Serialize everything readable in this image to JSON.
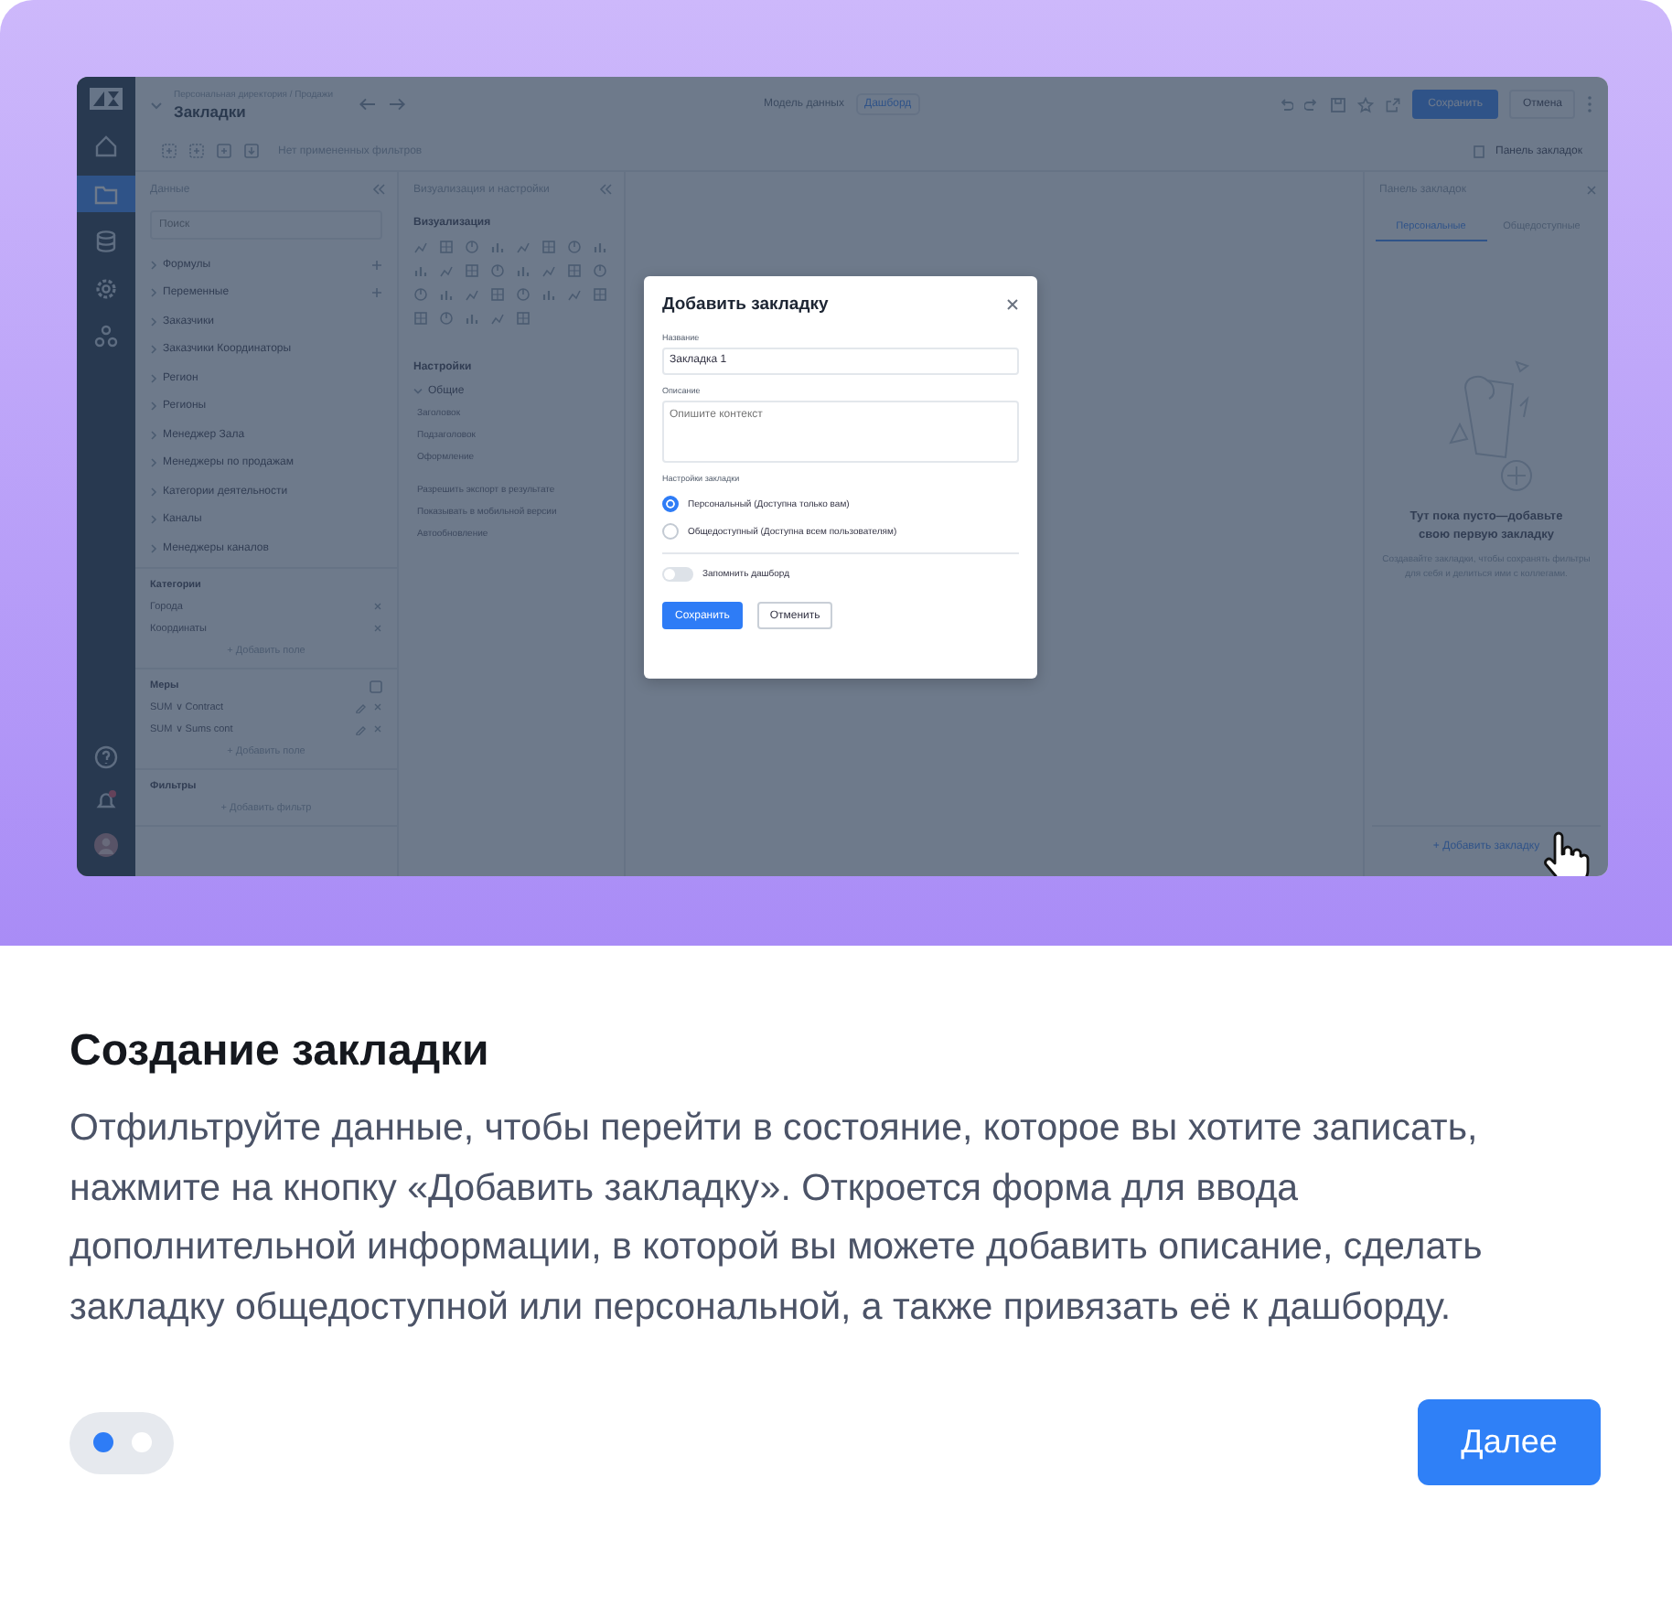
{
  "app": {
    "header": {
      "breadcrumb": "Персональная директория / Продажи",
      "title": "Закладки",
      "mode_label": "Модель данных",
      "mode_link": "Дашборд",
      "save": "Сохранить",
      "cancel": "Отмена",
      "filters_text": "Нет примененных фильтров",
      "bookmarks_toggle": "Панель закладок"
    },
    "data_panel": {
      "title": "Данные",
      "search_placeholder": "Поиск",
      "groups": [
        {
          "label": "Формулы",
          "addable": true
        },
        {
          "label": "Переменные",
          "addable": true
        },
        {
          "label": "Заказчики",
          "addable": false
        },
        {
          "label": "Заказчики Координаторы",
          "addable": false
        },
        {
          "label": "Регион",
          "addable": false
        },
        {
          "label": "Регионы",
          "addable": false
        },
        {
          "label": "Менеджер Зала",
          "addable": false
        },
        {
          "label": "Менеджеры по продажам",
          "addable": false
        },
        {
          "label": "Категории деятельности",
          "addable": false
        },
        {
          "label": "Каналы",
          "addable": false
        },
        {
          "label": "Менеджеры каналов",
          "addable": false
        }
      ],
      "sections": [
        {
          "title": "Категории",
          "fields": [
            {
              "label": "Города",
              "kind": "plain"
            },
            {
              "label": "Координаты",
              "kind": "plain"
            }
          ],
          "add": "+ Добавить поле"
        },
        {
          "title": "Меры",
          "fields": [
            {
              "label": "SUM ∨ Contract",
              "kind": "measure"
            },
            {
              "label": "SUM ∨ Sums cont",
              "kind": "measure"
            }
          ],
          "add": "+ Добавить поле"
        },
        {
          "title": "Фильтры",
          "add": "+ Добавить фильтр"
        }
      ]
    },
    "viz_panel": {
      "title": "Визуализация и настройки",
      "viz_heading": "Визуализация",
      "settings_heading": "Настройки",
      "group": "Общие",
      "items": [
        "Заголовок",
        "Подзаголовок",
        "Оформление",
        "Разрешить экспорт в результате",
        "Показывать в мобильной версии",
        "Автообновление"
      ]
    },
    "bookmarks_panel": {
      "title": "Панель закладок",
      "tabs": [
        {
          "label": "Персональные",
          "selected": true
        },
        {
          "label": "Общедоступные",
          "selected": false
        }
      ],
      "empty_title": "Тут пока пусто—добавьте свою первую закладку",
      "empty_text": "Создавайте закладки, чтобы сохранять фильтры для себя и делиться ими с коллегами.",
      "add_button": "+ Добавить закладку"
    }
  },
  "dialog": {
    "title": "Добавить закладку",
    "name_label": "Название",
    "name_value": "Закладка 1",
    "description_label": "Описание",
    "description_placeholder": "Опишите контекст",
    "settings_label": "Настройки закладки",
    "options": [
      {
        "label": "Персональный (Доступна только вам)",
        "selected": true
      },
      {
        "label": "Общедоступный (Доступна всем пользователям)",
        "selected": false
      }
    ],
    "toggle": {
      "label": "Запомнить дашборд",
      "on": false
    },
    "buttons": [
      {
        "label": "Сохранить",
        "kind": "primary"
      },
      {
        "label": "Отменить",
        "kind": "secondary"
      }
    ]
  },
  "tour": {
    "title": "Создание закладки",
    "text": "Отфильтруйте данные, чтобы перейти в состояние, которое вы хотите записать, нажмите на кнопку «Добавить закладку». Откроется форма для ввода дополнительной информации, в которой вы можете добавить описание, сделать закладку общедоступной или персональной, а также привязать её к дашборду.",
    "steps": [
      {
        "selected": true
      },
      {
        "selected": false
      }
    ],
    "next": "Далее"
  }
}
